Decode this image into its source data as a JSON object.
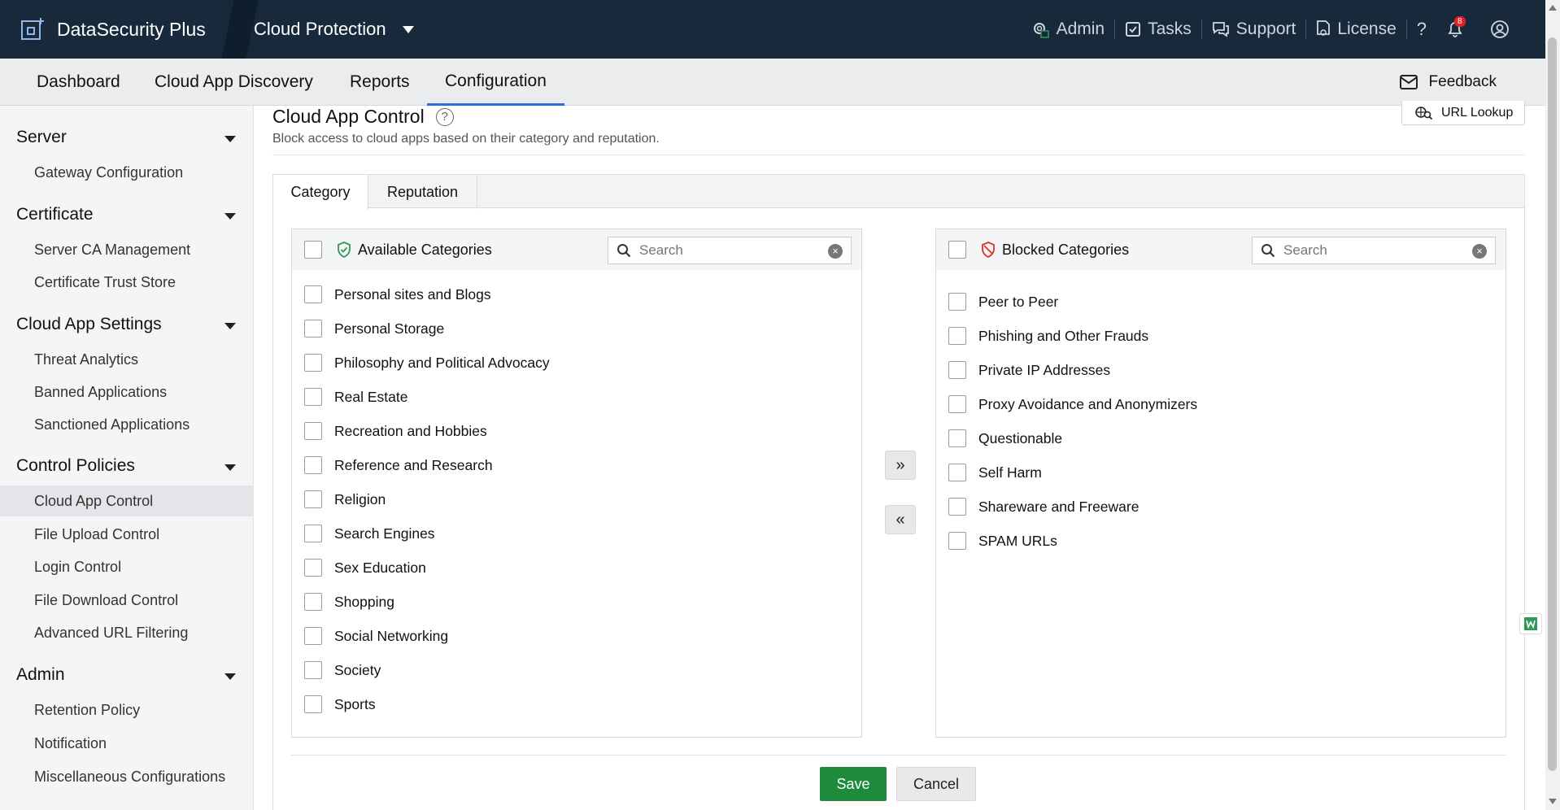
{
  "brand": {
    "name": "DataSecurity Plus",
    "product": "Cloud Protection"
  },
  "topright": {
    "admin": "Admin",
    "tasks": "Tasks",
    "support": "Support",
    "license": "License",
    "help": "?",
    "notif_count": "8"
  },
  "nav": {
    "tabs": [
      "Dashboard",
      "Cloud App Discovery",
      "Reports",
      "Configuration"
    ],
    "active": "Configuration",
    "feedback": "Feedback"
  },
  "sidebar": {
    "sections": [
      {
        "label": "Server",
        "items": [
          "Gateway Configuration"
        ]
      },
      {
        "label": "Certificate",
        "items": [
          "Server CA Management",
          "Certificate Trust Store"
        ]
      },
      {
        "label": "Cloud App Settings",
        "items": [
          "Threat Analytics",
          "Banned Applications",
          "Sanctioned Applications"
        ]
      },
      {
        "label": "Control Policies",
        "items": [
          "Cloud App Control",
          "File Upload Control",
          "Login Control",
          "File Download Control",
          "Advanced URL Filtering"
        ]
      },
      {
        "label": "Admin",
        "items": [
          "Retention Policy",
          "Notification",
          "Miscellaneous Configurations"
        ]
      }
    ],
    "selected": "Cloud App Control"
  },
  "page": {
    "title": "Cloud App Control",
    "help": "?",
    "description": "Block access to cloud apps based on their category and reputation.",
    "url_lookup": "URL Lookup",
    "tabs": [
      "Category",
      "Reputation"
    ],
    "active_tab": "Category"
  },
  "available": {
    "title": "Available Categories",
    "search_placeholder": "Search",
    "items": [
      "Personal sites and Blogs",
      "Personal Storage",
      "Philosophy and Political Advocacy",
      "Real Estate",
      "Recreation and Hobbies",
      "Reference and Research",
      "Religion",
      "Search Engines",
      "Sex Education",
      "Shopping",
      "Social Networking",
      "Society",
      "Sports"
    ]
  },
  "blocked": {
    "title": "Blocked Categories",
    "search_placeholder": "Search",
    "items": [
      "Peer to Peer",
      "Phishing and Other Frauds",
      "Private IP Addresses",
      "Proxy Avoidance and Anonymizers",
      "Questionable",
      "Self Harm",
      "Shareware and Freeware",
      "SPAM URLs"
    ]
  },
  "buttons": {
    "move_right": "»",
    "move_left": "«",
    "save": "Save",
    "cancel": "Cancel"
  },
  "colors": {
    "topbar": "#17293b",
    "accent": "#2a6ed8",
    "save": "#1e8a3c",
    "available_icon": "#2e9a55",
    "blocked_icon": "#d9342b"
  }
}
